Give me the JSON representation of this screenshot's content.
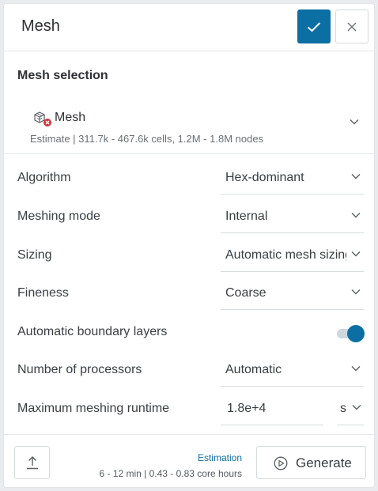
{
  "header": {
    "title": "Mesh"
  },
  "mesh_selection": {
    "section_title": "Mesh selection",
    "item_name": "Mesh",
    "estimate": "Estimate | 311.7k - 467.6k cells, 1.2M - 1.8M nodes",
    "icon": "mesh-error-icon"
  },
  "settings": {
    "algorithm": {
      "label": "Algorithm",
      "value": "Hex-dominant"
    },
    "meshing_mode": {
      "label": "Meshing mode",
      "value": "Internal"
    },
    "sizing": {
      "label": "Sizing",
      "value": "Automatic mesh sizing"
    },
    "fineness": {
      "label": "Fineness",
      "value": "Coarse"
    },
    "boundary_layers": {
      "label": "Automatic boundary layers",
      "enabled": true
    },
    "processors": {
      "label": "Number of processors",
      "value": "Automatic"
    },
    "runtime": {
      "label": "Maximum meshing runtime",
      "value": "1.8e+4",
      "unit": "s"
    }
  },
  "footer": {
    "estimation_label": "Estimation",
    "estimation_value": "6 - 12 min | 0.43 - 0.83 core hours",
    "generate_label": "Generate"
  },
  "colors": {
    "accent": "#0b6fa4",
    "error": "#d6343c"
  }
}
